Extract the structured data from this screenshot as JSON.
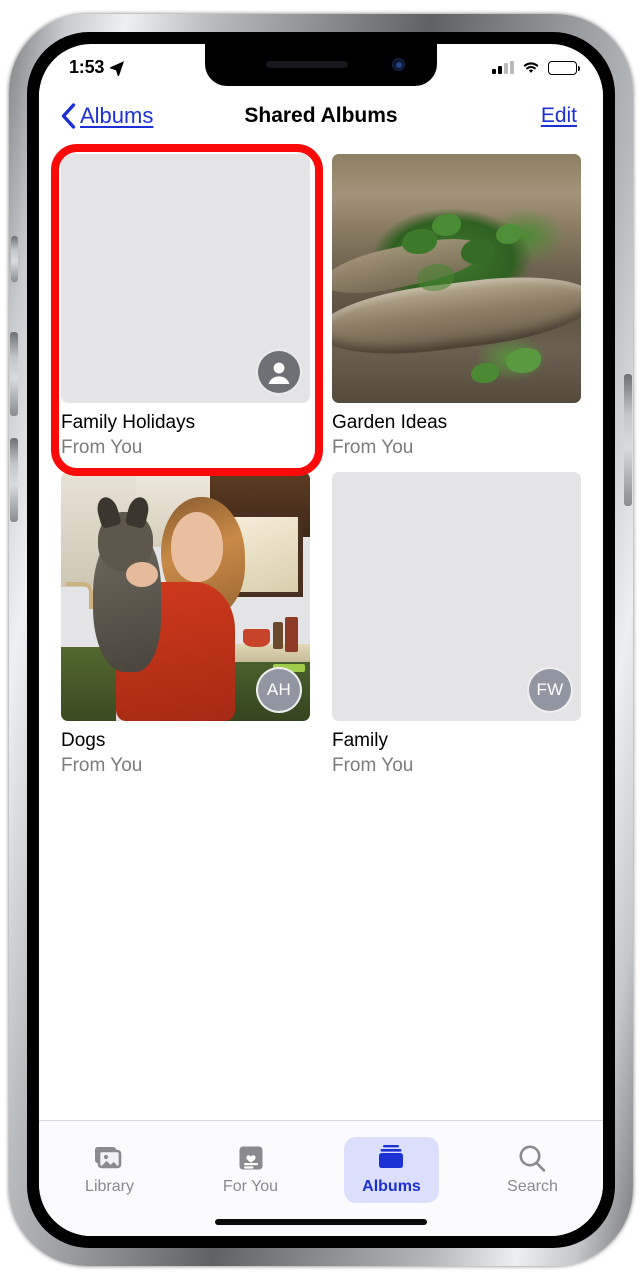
{
  "status_bar": {
    "time": "1:53",
    "location_icon": "location-arrow-icon",
    "signal_icon": "cellular-signal-icon",
    "signal_bars_filled": 2,
    "signal_bars_total": 4,
    "wifi_icon": "wifi-icon",
    "battery_icon": "battery-full-icon",
    "battery_level_percent": 100
  },
  "nav_bar": {
    "back_label": "Albums",
    "back_icon": "chevron-left-icon",
    "title": "Shared Albums",
    "edit_label": "Edit"
  },
  "albums": [
    {
      "title": "Family Holidays",
      "subtitle": "From You",
      "thumbnail": "placeholder-gray",
      "badge_type": "person-icon",
      "badge_initials": "",
      "highlighted": true
    },
    {
      "title": "Garden Ideas",
      "subtitle": "From You",
      "thumbnail": "garden-photo",
      "badge_type": "none",
      "badge_initials": "",
      "highlighted": false
    },
    {
      "title": "Dogs",
      "subtitle": "From You",
      "thumbnail": "dog-photo",
      "badge_type": "initials",
      "badge_initials": "AH",
      "highlighted": false
    },
    {
      "title": "Family",
      "subtitle": "From You",
      "thumbnail": "placeholder-gray",
      "badge_type": "initials",
      "badge_initials": "FW",
      "highlighted": false
    }
  ],
  "tab_bar": {
    "items": [
      {
        "label": "Library",
        "icon": "photos-library-icon",
        "active": false
      },
      {
        "label": "For You",
        "icon": "for-you-card-icon",
        "active": false
      },
      {
        "label": "Albums",
        "icon": "albums-folder-icon",
        "active": true
      },
      {
        "label": "Search",
        "icon": "search-magnifier-icon",
        "active": false
      }
    ]
  },
  "colors": {
    "accent_blue": "#1c31d4",
    "annotation_red": "#fb0a0a",
    "active_tab_bg": "#dcdffb",
    "placeholder_gray": "#e4e4e7",
    "secondary_text": "#7b7b80"
  }
}
